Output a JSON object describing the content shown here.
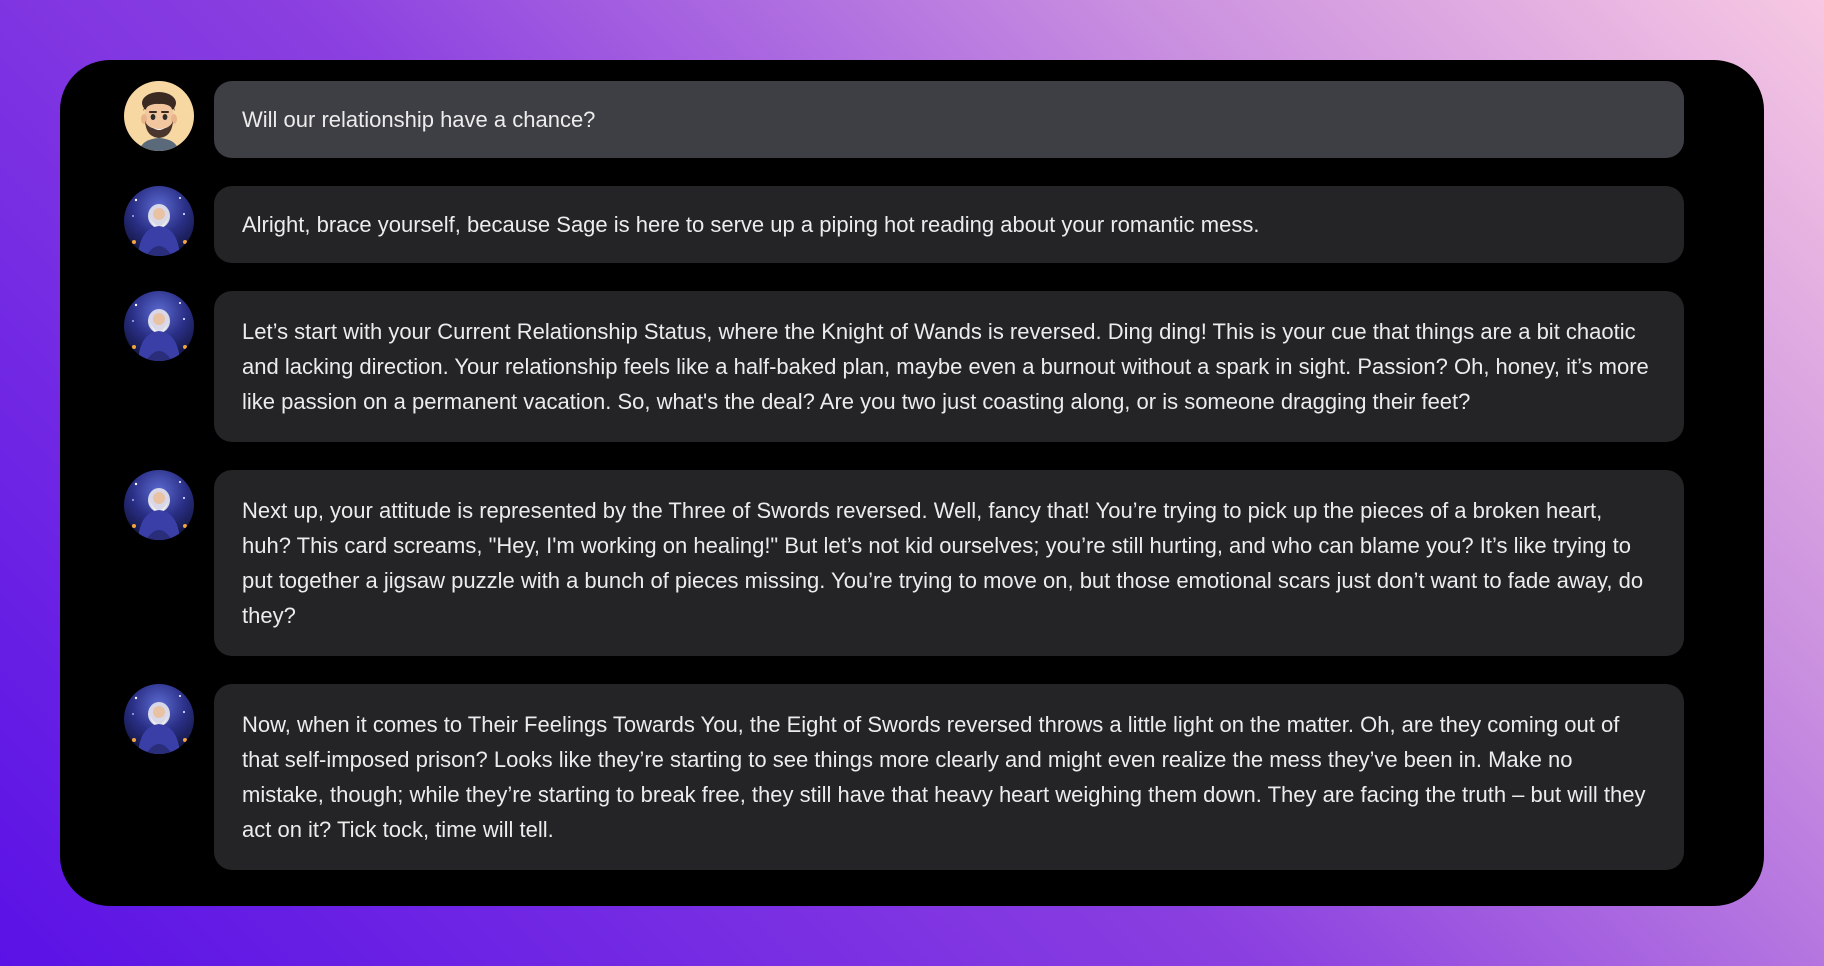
{
  "colors": {
    "window_bg": "#000000",
    "user_bubble": "#3e3f44",
    "bot_bubble": "#242426",
    "text": "#ececec"
  },
  "messages": [
    {
      "role": "user",
      "avatar_icon": "user-memoji-avatar",
      "text": "Will our relationship have a chance?"
    },
    {
      "role": "assistant",
      "avatar_icon": "sage-wizard-avatar",
      "text": "Alright, brace yourself, because Sage is here to serve up a piping hot reading about your romantic mess."
    },
    {
      "role": "assistant",
      "avatar_icon": "sage-wizard-avatar",
      "text": "Let’s start with your Current Relationship Status, where the Knight of Wands is reversed. Ding ding! This is your cue that things are a bit chaotic and lacking direction. Your relationship feels like a half-baked plan, maybe even a burnout without a spark in sight. Passion? Oh, honey, it’s more like passion on a permanent vacation. So, what's the deal? Are you two just coasting along, or is someone dragging their feet?"
    },
    {
      "role": "assistant",
      "avatar_icon": "sage-wizard-avatar",
      "text": "Next up, your attitude is represented by the Three of Swords reversed. Well, fancy that! You’re trying to pick up the pieces of a broken heart, huh? This card screams, \"Hey, I'm working on healing!\" But let’s not kid ourselves; you’re still hurting, and who can blame you? It’s like trying to put together a jigsaw puzzle with a bunch of pieces missing. You’re trying to move on, but those emotional scars just don’t want to fade away, do they?"
    },
    {
      "role": "assistant",
      "avatar_icon": "sage-wizard-avatar",
      "text": "Now, when it comes to Their Feelings Towards You, the Eight of Swords reversed throws a little light on the matter. Oh, are they coming out of that self-imposed prison? Looks like they’re starting to see things more clearly and might even realize the mess they’ve been in. Make no mistake, though; while they’re starting to break free, they still have that heavy heart weighing them down. They are facing the truth – but will they act on it? Tick tock, time will tell."
    }
  ]
}
